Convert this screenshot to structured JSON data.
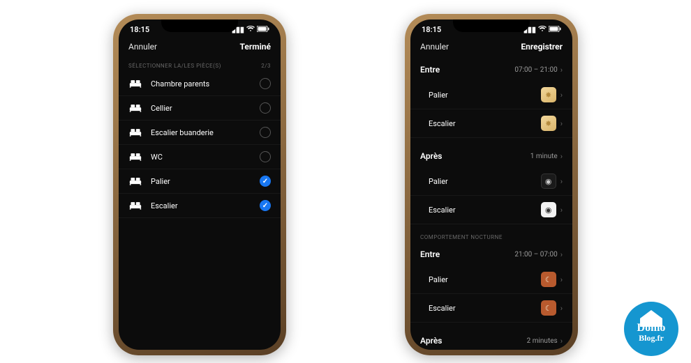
{
  "status": {
    "time": "18:15"
  },
  "left": {
    "nav": {
      "cancel": "Annuler",
      "done": "Terminé"
    },
    "section": {
      "title": "SÉLECTIONNER LA/LES PIÈCE(S)",
      "count": "2/3"
    },
    "rooms": [
      {
        "name": "Chambre parents",
        "selected": false
      },
      {
        "name": "Cellier",
        "selected": false
      },
      {
        "name": "Escalier buanderie",
        "selected": false
      },
      {
        "name": "WC",
        "selected": false
      },
      {
        "name": "Palier",
        "selected": true
      },
      {
        "name": "Escalier",
        "selected": true
      }
    ]
  },
  "right": {
    "nav": {
      "cancel": "Annuler",
      "done": "Enregistrer"
    },
    "day_between": {
      "label": "Entre",
      "value": "07:00 – 21:00"
    },
    "day_rooms": [
      {
        "name": "Palier",
        "chip": "warm"
      },
      {
        "name": "Escalier",
        "chip": "warm"
      }
    ],
    "day_after": {
      "label": "Après",
      "value": "1 minute"
    },
    "day_after_rooms": [
      {
        "name": "Palier",
        "chip": "dark"
      },
      {
        "name": "Escalier",
        "chip": "white"
      }
    ],
    "night_header": "COMPORTEMENT NOCTURNE",
    "night_between": {
      "label": "Entre",
      "value": "21:00 – 07:00"
    },
    "night_rooms": [
      {
        "name": "Palier",
        "chip": "night"
      },
      {
        "name": "Escalier",
        "chip": "night"
      }
    ],
    "night_after": {
      "label": "Après",
      "value": "2 minutes"
    }
  },
  "logo": {
    "line1": "Domo",
    "line2": "Blog.fr"
  }
}
